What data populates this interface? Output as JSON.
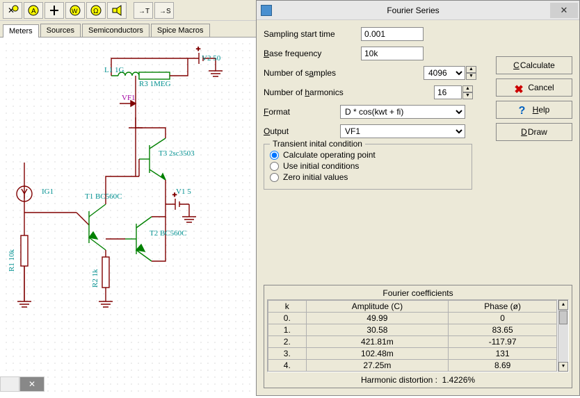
{
  "tabs": {
    "meters": "Meters",
    "sources": "Sources",
    "semiconductors": "Semiconductors",
    "spice": "Spice Macros"
  },
  "schematic": {
    "L1": "L1 1G",
    "R3": "R3 1MEG",
    "V2": "V2 50",
    "VF1": "VF1",
    "T3": "T3 2sc3503",
    "IG1": "IG1",
    "T1": "T1 BC560C",
    "T2": "T2 BC560C",
    "V1": "V1 5",
    "R1": "R1 10k",
    "R2": "R2 1k"
  },
  "dialog": {
    "title": "Fourier Series",
    "fields": {
      "sampling_label": "Sampling start time",
      "sampling_value": "0.001",
      "basefreq_label": "Base frequency",
      "basefreq_value": "10k",
      "samples_label": "Number of samples",
      "samples_value": "4096",
      "harmonics_label": "Number of harmonics",
      "harmonics_value": "16",
      "format_label": "Format",
      "format_value": "D * cos(kwt + fi)",
      "output_label": "Output",
      "output_value": "VF1"
    },
    "group": {
      "legend": "Transient inital condition",
      "opt1": "Calculate operating point",
      "opt2": "Use initial conditions",
      "opt3": "Zero initial values"
    },
    "buttons": {
      "calculate": "Calculate",
      "cancel": "Cancel",
      "help": "Help",
      "draw": "Draw"
    },
    "coeff": {
      "title": "Fourier coefficients",
      "headers": {
        "k": "k",
        "amp": "Amplitude (C)",
        "phase": "Phase (ø)"
      },
      "rows": [
        {
          "k": "0.",
          "amp": "49.99",
          "phase": "0"
        },
        {
          "k": "1.",
          "amp": "30.58",
          "phase": "83.65"
        },
        {
          "k": "2.",
          "amp": "421.81m",
          "phase": "-117.97"
        },
        {
          "k": "3.",
          "amp": "102.48m",
          "phase": "131"
        },
        {
          "k": "4.",
          "amp": "27.25m",
          "phase": "8.69"
        }
      ],
      "distortion_label": "Harmonic distortion :",
      "distortion_value": "1.4226%"
    }
  },
  "toolbar_items": [
    "V",
    "A",
    "+",
    "W",
    "Ω",
    "spk",
    "T",
    "S"
  ]
}
